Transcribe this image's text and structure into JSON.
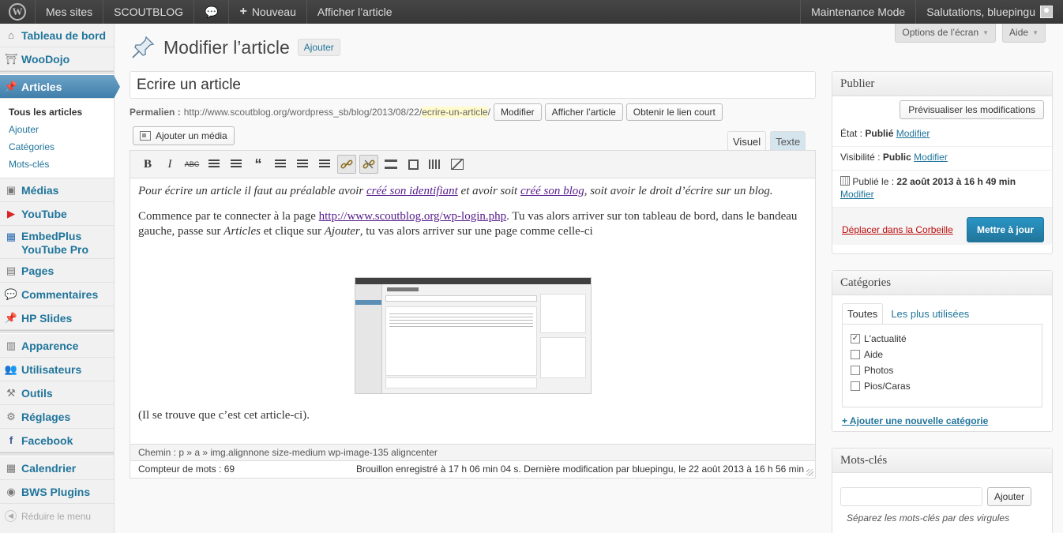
{
  "adminbar": {
    "my_sites": "Mes sites",
    "site_name": "SCOUTBLOG",
    "new_label": "Nouveau",
    "view_post": "Afficher l’article",
    "maintenance": "Maintenance Mode",
    "greeting": "Salutations, bluepingu"
  },
  "sidebar": {
    "items": [
      {
        "label": "Tableau de bord",
        "icon": "dashboard-icon"
      },
      {
        "label": "WooDojo",
        "icon": "woodojo-icon"
      },
      {
        "label": "Articles",
        "icon": "pin-icon"
      },
      {
        "label": "Médias",
        "icon": "media-icon"
      },
      {
        "label": "YouTube",
        "icon": "youtube-icon"
      },
      {
        "label": "EmbedPlus YouTube Pro",
        "icon": "embedplus-icon"
      },
      {
        "label": "Pages",
        "icon": "pages-icon"
      },
      {
        "label": "Commentaires",
        "icon": "comments-icon"
      },
      {
        "label": "HP Slides",
        "icon": "slides-icon"
      },
      {
        "label": "Apparence",
        "icon": "appearance-icon"
      },
      {
        "label": "Utilisateurs",
        "icon": "users-icon"
      },
      {
        "label": "Outils",
        "icon": "tools-icon"
      },
      {
        "label": "Réglages",
        "icon": "settings-icon"
      },
      {
        "label": "Facebook",
        "icon": "facebook-icon"
      },
      {
        "label": "Calendrier",
        "icon": "calendar-icon"
      },
      {
        "label": "BWS Plugins",
        "icon": "bws-icon"
      }
    ],
    "submenu": [
      "Tous les articles",
      "Ajouter",
      "Catégories",
      "Mots-clés"
    ],
    "collapse": "Réduire le menu"
  },
  "screen": {
    "options": "Options de l’écran",
    "help": "Aide"
  },
  "header": {
    "title": "Modifier l’article",
    "add_new": "Ajouter"
  },
  "post": {
    "title": "Ecrire un article",
    "permalink_label": "Permalien :",
    "permalink_base": "http://www.scoutblog.org/wordpress_sb/blog/2013/08/22/",
    "permalink_slug": "ecrire-un-article",
    "permalink_tail": "/",
    "edit_btn": "Modifier",
    "view_btn": "Afficher l’article",
    "shortlink_btn": "Obtenir le lien court",
    "add_media": "Ajouter un média",
    "tab_visual": "Visuel",
    "tab_text": "Texte"
  },
  "content": {
    "p1_a": "Pour écrire un article il faut au préalable avoir ",
    "p1_link1": "créé son identifiant",
    "p1_b": " et avoir soit ",
    "p1_link2": "créé son blog",
    "p1_c": ", soit avoir le droit d’écrire sur un blog.",
    "p2_a": "Commence par te connecter à la page ",
    "p2_link": "http://www.scoutblog.org/wp-login.php",
    "p2_b": ". Tu vas alors arriver sur ton tableau de bord, dans le bandeau gauche, passe sur ",
    "p2_i1": "Articles",
    "p2_c": " et clique sur ",
    "p2_i2": "Ajouter",
    "p2_d": ", tu vas alors arriver sur une page comme celle-ci",
    "p3": "(Il se trouve que c’est cet article-ci)."
  },
  "editor_footer": {
    "path": "Chemin : p » a » img.alignnone size-medium wp-image-135 aligncenter",
    "word_count": "Compteur de mots : 69",
    "draft": "Brouillon enregistré à 17 h 06 min 04 s. Dernière modification par bluepingu, le 22 août 2013 à 16 h 56 min"
  },
  "publish": {
    "title": "Publier",
    "preview": "Prévisualiser les modifications",
    "status_label": "État :",
    "status_value": "Publié",
    "visibility_label": "Visibilité :",
    "visibility_value": "Public",
    "modify": "Modifier",
    "published_label": "Publié le :",
    "published_value": "22 août 2013 à 16 h 49 min",
    "trash": "Déplacer dans la Corbeille",
    "update": "Mettre à jour"
  },
  "categories": {
    "title": "Catégories",
    "tab_all": "Toutes",
    "tab_popular": "Les plus utilisées",
    "items": [
      {
        "label": "L'actualité",
        "checked": "✓"
      },
      {
        "label": "Aide",
        "checked": ""
      },
      {
        "label": "Photos",
        "checked": ""
      },
      {
        "label": "Pios/Caras",
        "checked": ""
      }
    ],
    "add_new": "+ Ajouter une nouvelle catégorie"
  },
  "tags": {
    "title": "Mots-clés",
    "add_btn": "Ajouter",
    "hint": "Séparez les mots-clés par des virgules"
  },
  "colors": {
    "accent": "#21759b",
    "adminbar": "#464646",
    "active_menu": "#4f8cb8"
  }
}
